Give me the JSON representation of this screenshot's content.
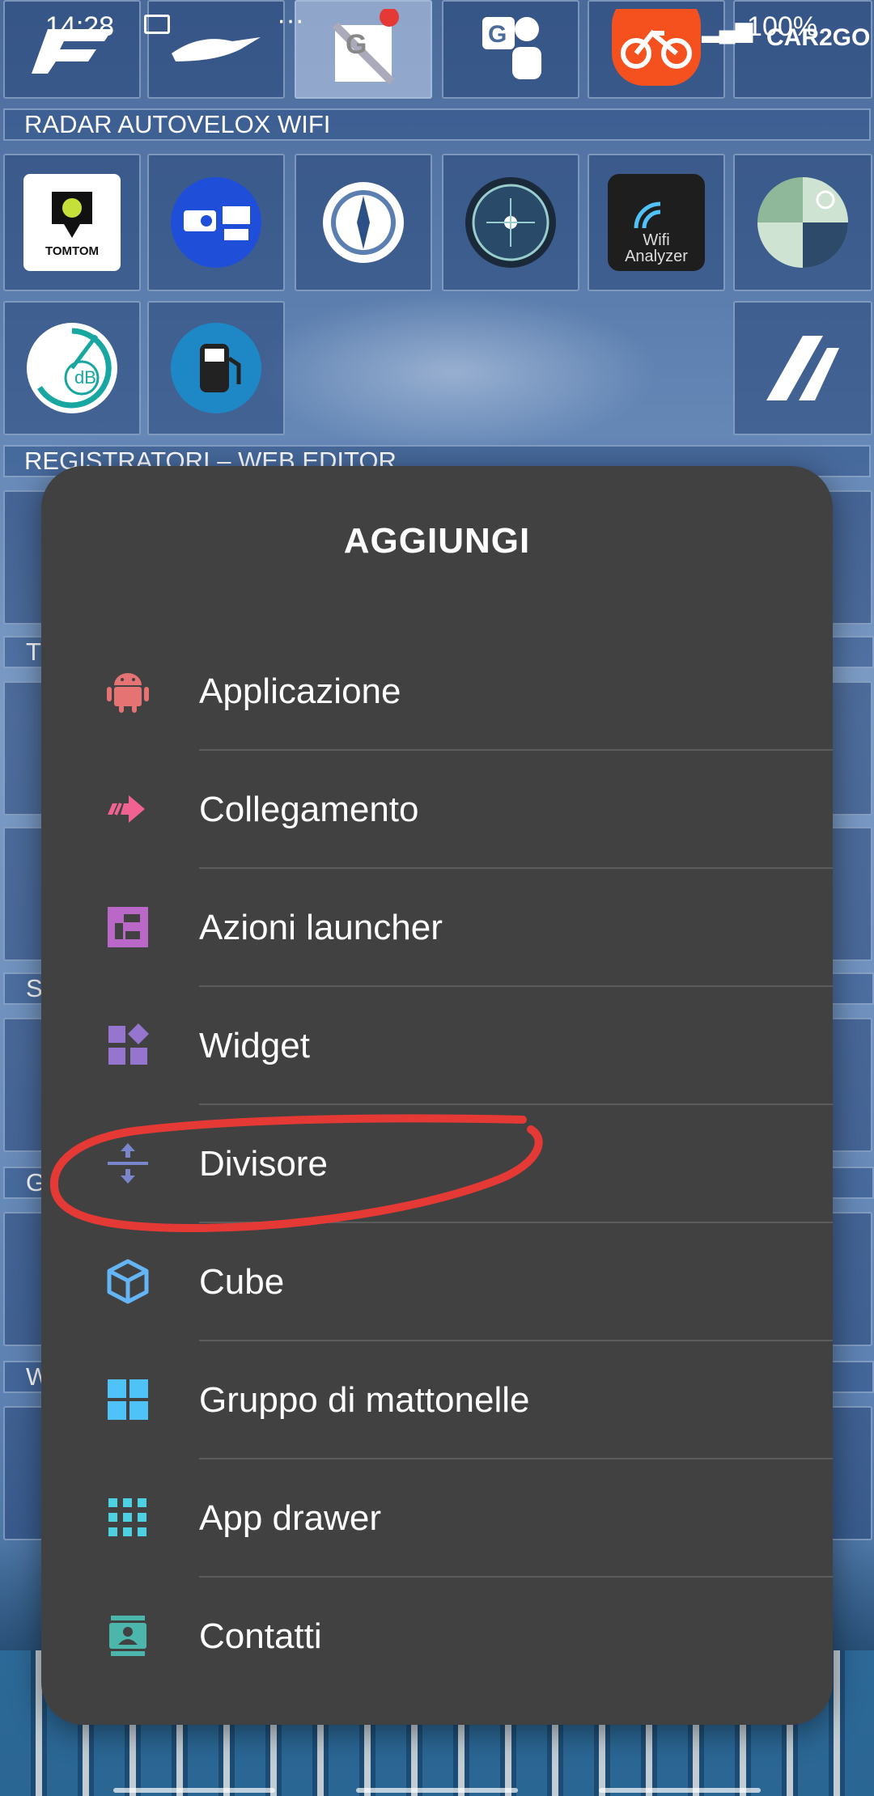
{
  "status_bar": {
    "time": "14:28",
    "battery": "100%",
    "overflow": "···"
  },
  "home": {
    "section_radar": "RADAR AUTOVELOX WIFI",
    "section_registratori": "REGISTRATORI – WEB EDITOR",
    "section_stubs": [
      "T",
      "S",
      "G",
      "W"
    ],
    "apps": {
      "tomtom": "TOMTOM",
      "db_meter": "dB",
      "wifi_analyzer": "Wifi Analyzer",
      "car2go": "CAR2GO"
    }
  },
  "dialog": {
    "title": "AGGIUNGI",
    "items": [
      {
        "label": "Applicazione",
        "icon": "android-icon",
        "color": "#e57373"
      },
      {
        "label": "Collegamento",
        "icon": "shortcut-arrow-icon",
        "color": "#f06292"
      },
      {
        "label": "Azioni launcher",
        "icon": "launcher-actions-icon",
        "color": "#ba68c8"
      },
      {
        "label": "Widget",
        "icon": "widget-icon",
        "color": "#9575cd"
      },
      {
        "label": "Divisore",
        "icon": "divider-icon",
        "color": "#7986cb"
      },
      {
        "label": "Cube",
        "icon": "cube-icon",
        "color": "#64b5f6"
      },
      {
        "label": "Gruppo di mattonelle",
        "icon": "tile-group-icon",
        "color": "#4fc3f7"
      },
      {
        "label": "App drawer",
        "icon": "app-drawer-icon",
        "color": "#4dd0e1"
      },
      {
        "label": "Contatti",
        "icon": "contacts-icon",
        "color": "#4db6ac"
      }
    ]
  },
  "colors": {
    "dialog_bg": "#414141",
    "annotation": "#e53935"
  }
}
